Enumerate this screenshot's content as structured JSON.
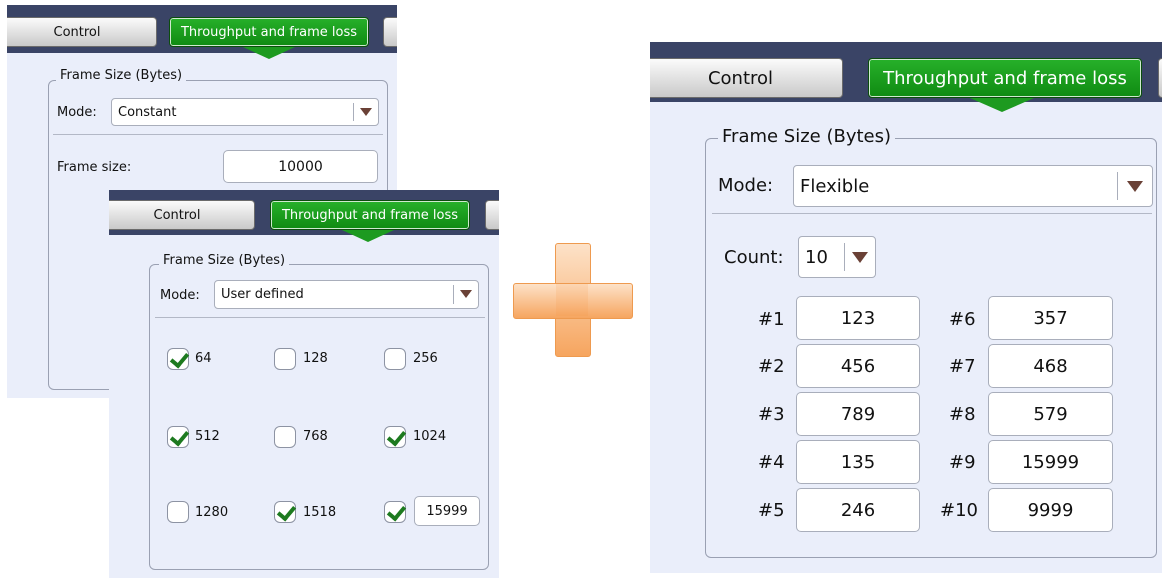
{
  "panel_constant": {
    "tabs": {
      "control": "Control",
      "throughput": "Throughput and frame loss"
    },
    "group_title": "Frame Size (Bytes)",
    "mode_label": "Mode:",
    "mode_value": "Constant",
    "frame_size_label": "Frame size:",
    "frame_size_value": "10000"
  },
  "panel_user_defined": {
    "tabs": {
      "control": "Control",
      "throughput": "Throughput and frame loss"
    },
    "group_title": "Frame Size (Bytes)",
    "mode_label": "Mode:",
    "mode_value": "User defined",
    "checkboxes": [
      {
        "label": "64",
        "checked": true
      },
      {
        "label": "128",
        "checked": false
      },
      {
        "label": "256",
        "checked": false
      },
      {
        "label": "512",
        "checked": true
      },
      {
        "label": "768",
        "checked": false
      },
      {
        "label": "1024",
        "checked": true
      },
      {
        "label": "1280",
        "checked": false
      },
      {
        "label": "1518",
        "checked": true
      },
      {
        "label": "",
        "checked": true,
        "custom_value": "15999"
      }
    ]
  },
  "panel_flexible": {
    "tabs": {
      "control": "Control",
      "throughput": "Throughput and frame loss"
    },
    "group_title": "Frame Size (Bytes)",
    "mode_label": "Mode:",
    "mode_value": "Flexible",
    "count_label": "Count:",
    "count_value": "10",
    "frames": [
      {
        "label": "#1",
        "value": "123"
      },
      {
        "label": "#2",
        "value": "456"
      },
      {
        "label": "#3",
        "value": "789"
      },
      {
        "label": "#4",
        "value": "135"
      },
      {
        "label": "#5",
        "value": "246"
      },
      {
        "label": "#6",
        "value": "357"
      },
      {
        "label": "#7",
        "value": "468"
      },
      {
        "label": "#8",
        "value": "579"
      },
      {
        "label": "#9",
        "value": "15999"
      },
      {
        "label": "#10",
        "value": "9999"
      }
    ]
  },
  "colors": {
    "tab_active": "#1d9a20",
    "panel_bg": "#eaeefa",
    "plus": "#f6a55f",
    "dropdown_arrow": "#6a4136"
  }
}
